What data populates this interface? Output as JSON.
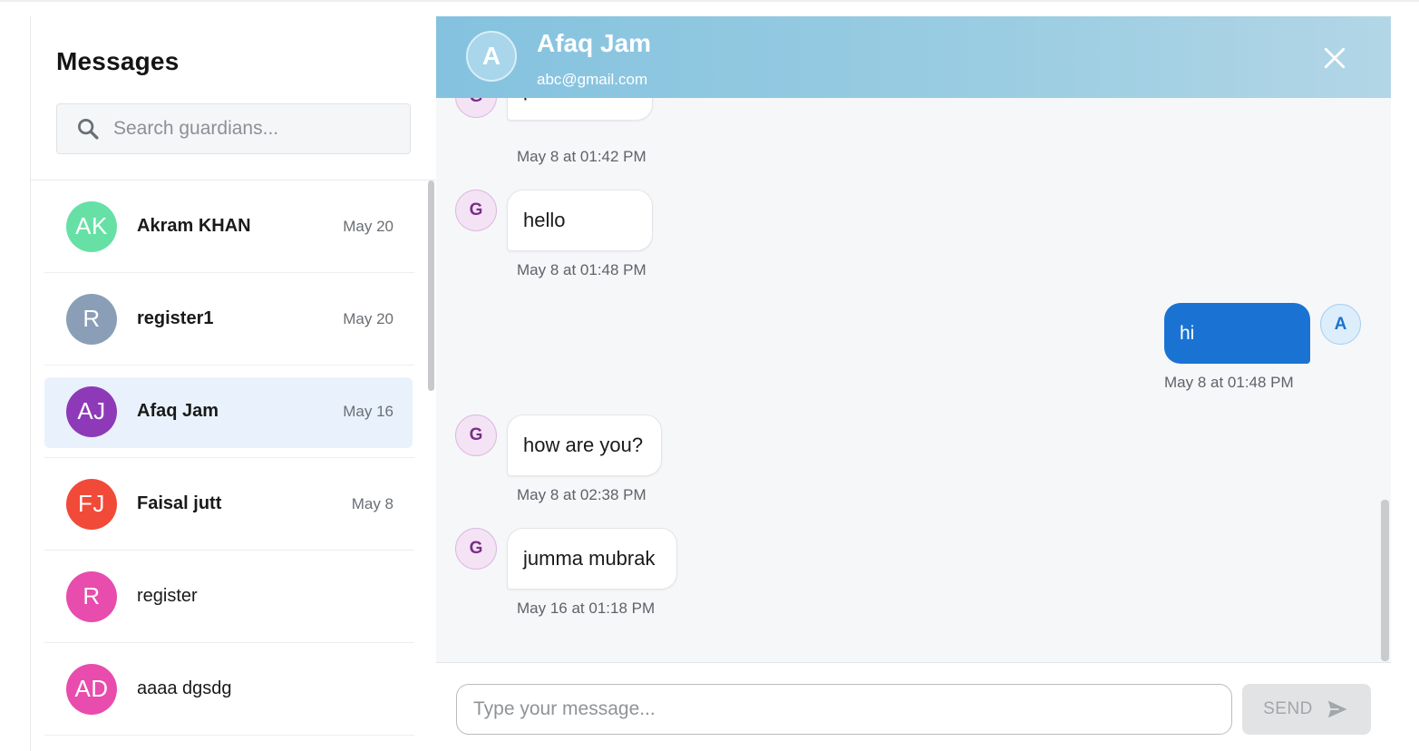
{
  "sidebar": {
    "title": "Messages",
    "search": {
      "placeholder": "Search guardians...",
      "value": ""
    },
    "contacts": [
      {
        "initials": "AK",
        "name": "Akram KHAN",
        "date": "May 20",
        "color": "#67e0a6",
        "bold": true,
        "active": false
      },
      {
        "initials": "R",
        "name": "register1",
        "date": "May 20",
        "color": "#8a9fb7",
        "bold": true,
        "active": false
      },
      {
        "initials": "AJ",
        "name": "Afaq Jam",
        "date": "May 16",
        "color": "#8e3ab8",
        "bold": true,
        "active": true
      },
      {
        "initials": "FJ",
        "name": "Faisal jutt",
        "date": "May 8",
        "color": "#f14a38",
        "bold": true,
        "active": false
      },
      {
        "initials": "R",
        "name": "register",
        "date": "",
        "color": "#e84cad",
        "bold": false,
        "active": false
      },
      {
        "initials": "AD",
        "name": "aaaa dgsdg",
        "date": "",
        "color": "#e84cad",
        "bold": false,
        "active": false
      }
    ]
  },
  "chat": {
    "header": {
      "avatar_initial": "A",
      "name": "Afaq Jam",
      "email": "abc@gmail.com"
    },
    "messages": [
      {
        "direction": "in",
        "sender_initial": "G",
        "text": "portal",
        "time": "May 8 at 01:42 PM"
      },
      {
        "direction": "in",
        "sender_initial": "G",
        "text": "hello",
        "time": "May 8 at 01:48 PM"
      },
      {
        "direction": "out",
        "sender_initial": "A",
        "text": "hi",
        "time": "May 8 at 01:48 PM"
      },
      {
        "direction": "in",
        "sender_initial": "G",
        "text": "how are you?",
        "time": "May 8 at 02:38 PM"
      },
      {
        "direction": "in",
        "sender_initial": "G",
        "text": "jumma mubrak",
        "time": "May 16 at 01:18 PM"
      }
    ],
    "composer": {
      "placeholder": "Type your message...",
      "value": "",
      "send_label": "SEND"
    }
  },
  "icons": {
    "search": "search-icon",
    "close": "close-icon",
    "send": "send-icon"
  },
  "colors": {
    "accent": "#1a73d2",
    "header_gradient_start": "#84c2df",
    "active_row": "#e9f2fc"
  }
}
